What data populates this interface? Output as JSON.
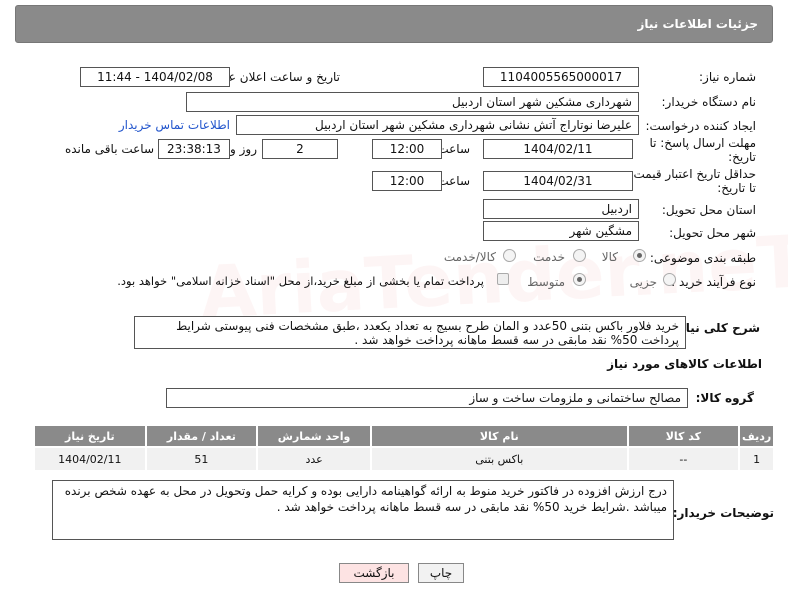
{
  "header": {
    "title": "جزئیات اطلاعات نیاز"
  },
  "fields": {
    "need_number": {
      "label": "شماره نیاز:",
      "value": "1104005565000017"
    },
    "announce_datetime": {
      "label": "تاریخ و ساعت اعلان عمومی:",
      "value": "1404/02/08 - 11:44"
    },
    "buyer_org": {
      "label": "نام دستگاه خریدار:",
      "value": "شهرداری مشکین شهر استان اردبیل"
    },
    "requester": {
      "label": "ایجاد کننده درخواست:",
      "value": "علیرضا نوتاراج آتش نشانی شهرداری مشکین شهر استان اردبیل",
      "contact_link": "اطلاعات تماس خریدار"
    },
    "deadline": {
      "label_line1": "مهلت ارسال پاسخ: تا",
      "label_line2": "تاریخ:",
      "date": "1404/02/11",
      "time_label": "ساعت",
      "time": "12:00",
      "days": "2",
      "days_label": "روز و",
      "remaining": "23:38:13",
      "remaining_label": "ساعت باقی مانده"
    },
    "price_validity": {
      "label_line1": "حداقل تاریخ اعتبار قیمت:",
      "label_line2": "تا تاریخ:",
      "date": "1404/02/31",
      "time_label": "ساعت",
      "time": "12:00"
    },
    "delivery_province": {
      "label": "استان محل تحویل:",
      "value": "اردبیل"
    },
    "delivery_city": {
      "label": "شهر محل تحویل:",
      "value": "مشگین شهر"
    },
    "category": {
      "label": "طبقه بندی موضوعی:",
      "options": [
        "کالا",
        "خدمت",
        "کالا/خدمت"
      ],
      "selected": "کالا"
    },
    "process": {
      "label": "نوع فرآیند خرید :",
      "options": [
        "جزیی",
        "متوسط"
      ],
      "selected": "متوسط",
      "payment_note": "پرداخت تمام یا بخشی از مبلغ خرید،از محل \"اسناد خزانه اسلامی\" خواهد بود."
    }
  },
  "description": {
    "label": "شرح کلی نیاز:",
    "text": "خرید فلاور باکس بتنی 50عدد و المان طرح بسیج  به تعداد یکعدد ،طبق مشخصات فنی پیوستی شرایط پرداخت 50% نقد مابقی در سه قسط ماهانه پرداخت خواهد شد ."
  },
  "goods": {
    "section_title": "اطلاعات کالاهای مورد نیاز",
    "group_label": "گروه کالا:",
    "group_value": "مصالح ساختمانی و ملزومات ساخت و ساز",
    "columns": [
      "ردیف",
      "کد کالا",
      "نام کالا",
      "واحد شمارش",
      "تعداد / مقدار",
      "تاریخ نیاز"
    ],
    "rows": [
      {
        "row": "1",
        "code": "--",
        "name": "باکس بتنی",
        "unit": "عدد",
        "qty": "51",
        "date": "1404/02/11"
      }
    ]
  },
  "buyer_notes": {
    "label": "توضیحات خریدار:",
    "text": "درج ارزش افزوده در فاکتور خرید منوط به ارائه گواهینامه دارایی بوده و کرایه حمل وتحویل در محل به عهده شخص برنده میباشد .شرایط خرید 50% نقد مابقی در سه قسط ماهانه پرداخت خواهد شد ."
  },
  "buttons": {
    "print": "چاپ",
    "back": "بازگشت"
  },
  "colors": {
    "header_bg": "#8a8a8a",
    "link": "#2255cc",
    "back_button_bg": "#fde3e3"
  }
}
